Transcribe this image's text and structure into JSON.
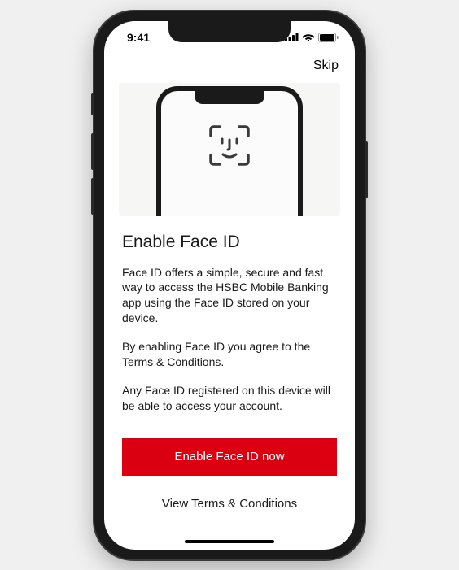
{
  "status": {
    "time": "9:41"
  },
  "topbar": {
    "skip_label": "Skip"
  },
  "content": {
    "heading": "Enable Face ID",
    "paragraph1": "Face ID offers a simple, secure and fast way to access the HSBC Mobile Banking app using the Face ID stored on your device.",
    "paragraph2": "By enabling Face ID you agree to the Terms & Conditions.",
    "paragraph3": "Any Face ID registered on this device will be able to access your account."
  },
  "actions": {
    "primary_label": "Enable Face ID now",
    "secondary_label": "View Terms & Conditions"
  },
  "colors": {
    "brand_primary": "#db0011"
  }
}
